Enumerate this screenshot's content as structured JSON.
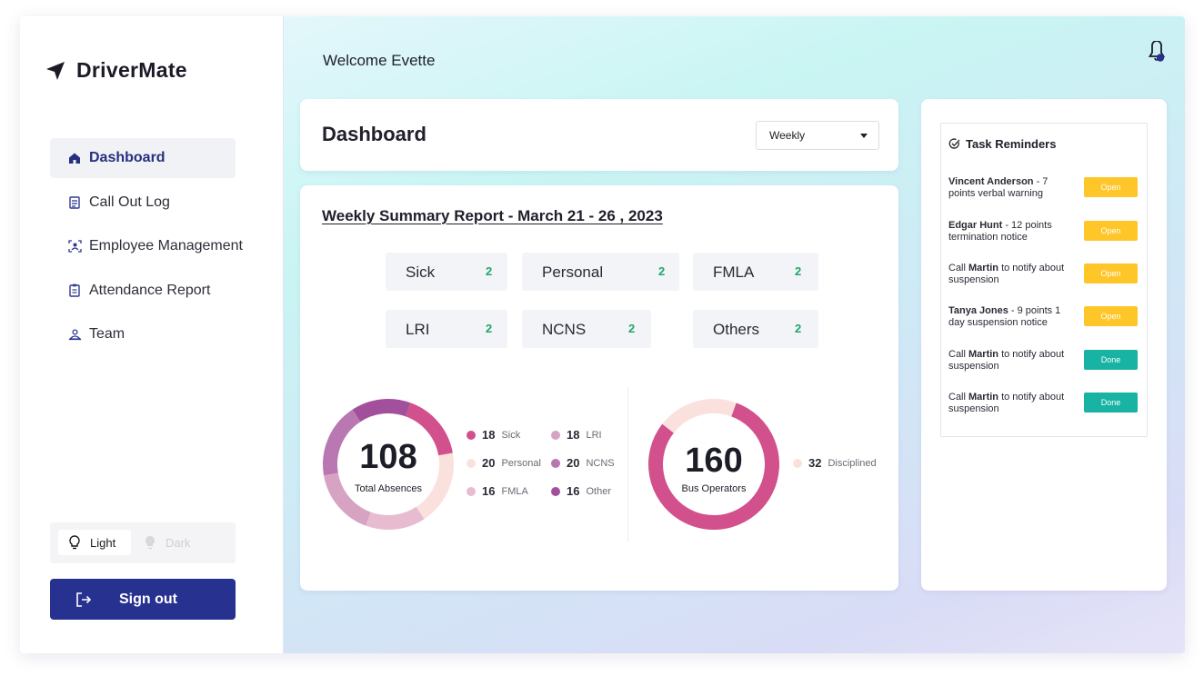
{
  "app": {
    "name": "DriverMate"
  },
  "sidebar": {
    "items": [
      {
        "label": "Dashboard",
        "icon": "home-icon",
        "active": true
      },
      {
        "label": "Call Out Log",
        "icon": "log-icon"
      },
      {
        "label": "Employee Management",
        "icon": "employee-icon"
      },
      {
        "label": "Attendance Report",
        "icon": "clipboard-icon"
      },
      {
        "label": "Team",
        "icon": "team-icon"
      }
    ],
    "theme": {
      "light": "Light",
      "dark": "Dark"
    },
    "signout": "Sign out"
  },
  "header": {
    "welcome": "Welcome Evette"
  },
  "dashboard": {
    "title": "Dashboard",
    "period": "Weekly"
  },
  "summary": {
    "title": "Weekly Summary Report - March 21 - 26 , 2023",
    "tiles": [
      {
        "label": "Sick",
        "value": "2"
      },
      {
        "label": "Personal",
        "value": "2"
      },
      {
        "label": "FMLA",
        "value": "2"
      },
      {
        "label": "LRI",
        "value": "2"
      },
      {
        "label": "NCNS",
        "value": "2"
      },
      {
        "label": "Others",
        "value": "2"
      }
    ],
    "absences": {
      "total": "108",
      "label": "Total Absences",
      "legend": [
        {
          "value": "18",
          "label": "Sick",
          "color": "#d2508c"
        },
        {
          "value": "20",
          "label": "Personal",
          "color": "#fbe1de"
        },
        {
          "value": "16",
          "label": "FMLA",
          "color": "#e8bcd0"
        },
        {
          "value": "18",
          "label": "LRI",
          "color": "#d7a3c2"
        },
        {
          "value": "20",
          "label": "NCNS",
          "color": "#b978b1"
        },
        {
          "value": "16",
          "label": "Other",
          "color": "#a2509b"
        }
      ]
    },
    "operators": {
      "total": "160",
      "label": "Bus Operators",
      "legend": [
        {
          "value": "32",
          "label": "Disciplined",
          "color": "#fbe1de"
        }
      ],
      "main_color": "#d2508c"
    }
  },
  "tasks": {
    "title": "Task Reminders",
    "items": [
      {
        "bold": "Vincent Anderson",
        "pre": "",
        "text": " - 7 points verbal warning",
        "status": "Open"
      },
      {
        "bold": "Edgar Hunt",
        "pre": "",
        "text": " - 12 points termination notice",
        "status": "Open"
      },
      {
        "bold": "Martin",
        "pre": "Call ",
        "text": " to notify about suspension",
        "status": "Open"
      },
      {
        "bold": "Tanya Jones",
        "pre": "",
        "text": " - 9 points 1 day suspension notice",
        "status": "Open"
      },
      {
        "bold": "Martin",
        "pre": "Call ",
        "text": " to notify about suspension",
        "status": "Done"
      },
      {
        "bold": "Martin",
        "pre": "Call ",
        "text": " to notify about suspension",
        "status": "Done"
      }
    ]
  }
}
